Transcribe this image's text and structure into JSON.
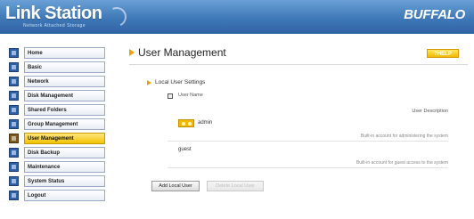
{
  "header": {
    "app_title": "Link Station",
    "tagline": "Network Attached Storage",
    "vendor": "BUFFALO"
  },
  "sidebar": {
    "items": [
      {
        "label": "Home",
        "icon": "home-icon"
      },
      {
        "label": "Basic",
        "icon": "basic-icon"
      },
      {
        "label": "Network",
        "icon": "network-icon"
      },
      {
        "label": "Disk Management",
        "icon": "disk-icon"
      },
      {
        "label": "Shared Folders",
        "icon": "folder-icon"
      },
      {
        "label": "Group Management",
        "icon": "group-icon"
      },
      {
        "label": "User Management",
        "icon": "user-icon",
        "active": true
      },
      {
        "label": "Disk Backup",
        "icon": "backup-icon"
      },
      {
        "label": "Maintenance",
        "icon": "maintenance-icon"
      },
      {
        "label": "System Status",
        "icon": "status-icon"
      },
      {
        "label": "Logout",
        "icon": "logout-icon"
      }
    ]
  },
  "main": {
    "page_title": "User Management",
    "help_label": "?HELP",
    "section_title": "Local User Settings",
    "table": {
      "col_name": "User Name",
      "col_description": "User Description",
      "rows": [
        {
          "name": "admin",
          "description": "Built-in account for administering the system"
        },
        {
          "name": "guest",
          "description": "Built-in account for guest access to the system"
        }
      ]
    },
    "buttons": {
      "add": "Add Local User",
      "delete": "Delete Local User"
    }
  },
  "colors": {
    "header_blue": "#3f78b8",
    "active_yellow": "#f2c200",
    "accent_orange": "#f0a000"
  }
}
